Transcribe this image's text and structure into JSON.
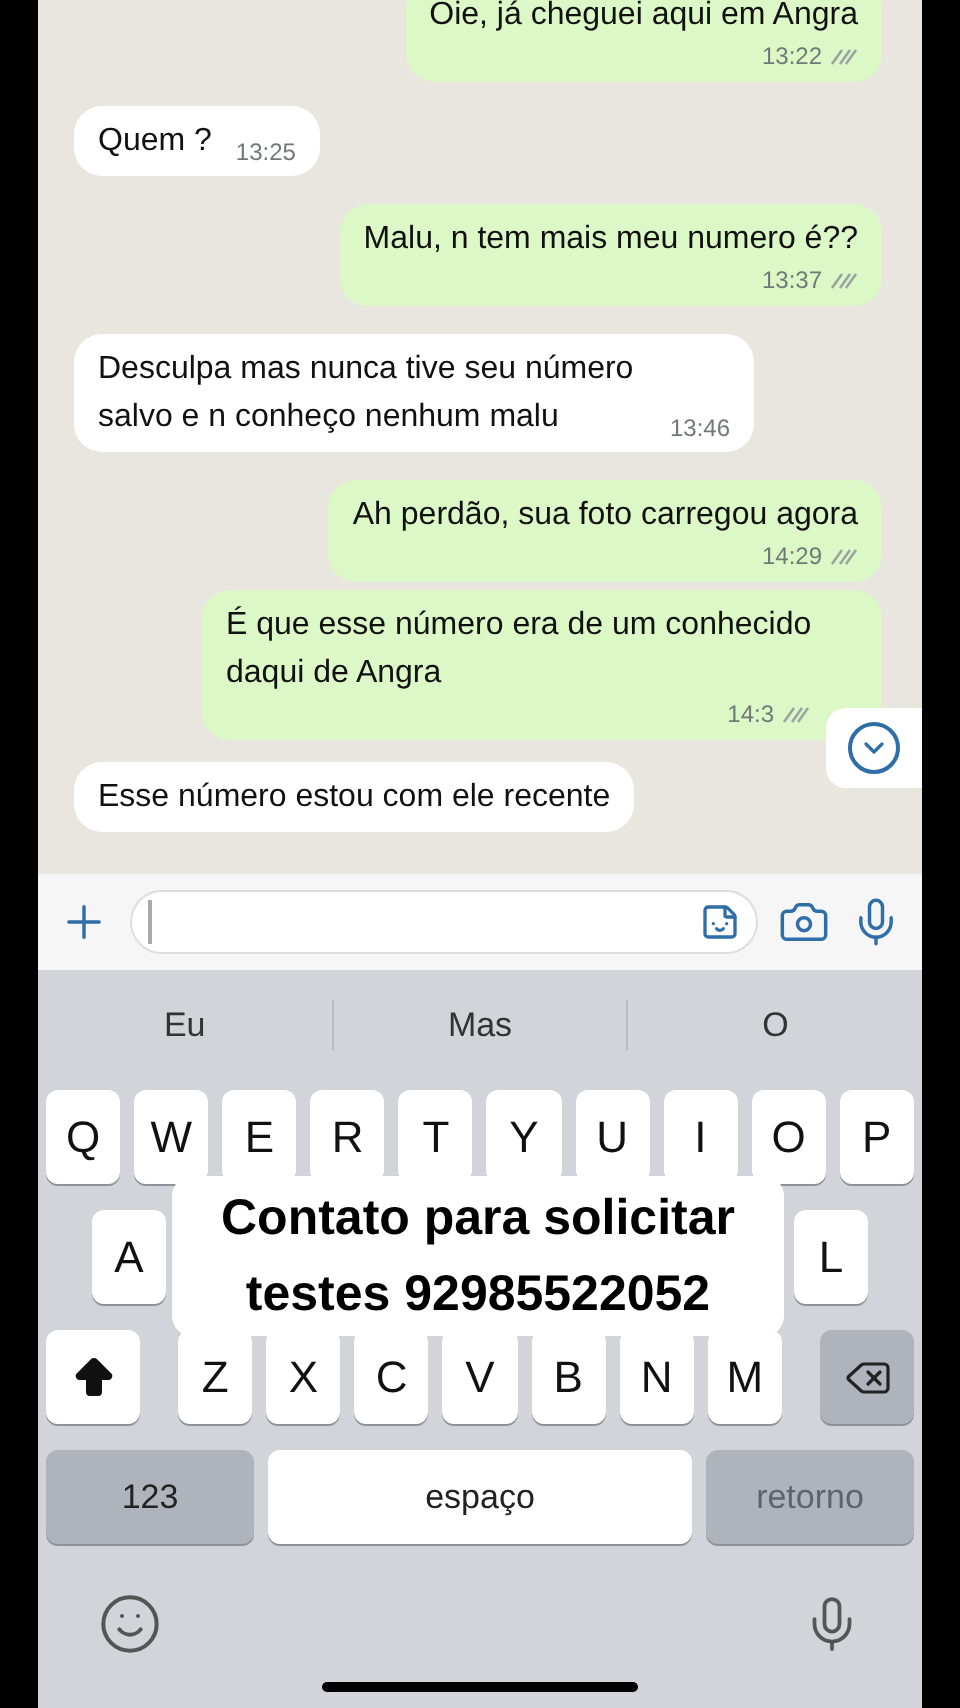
{
  "messages": [
    {
      "kind": "sent",
      "text": "Oie, já cheguei aqui em Angra",
      "time": "13:22"
    },
    {
      "kind": "received",
      "text": "Quem ?",
      "time": "13:25"
    },
    {
      "kind": "sent",
      "text": "Malu, n tem mais meu numero é??",
      "time": "13:37"
    },
    {
      "kind": "received",
      "text": "Desculpa mas nunca tive seu número salvo e n conheço nenhum malu",
      "time": "13:46"
    },
    {
      "kind": "sent",
      "text": "Ah perdão, sua foto carregou agora",
      "time": "14:29"
    },
    {
      "kind": "sent",
      "text": "É que esse número era de um conhecido daqui de Angra",
      "time": "14:3"
    },
    {
      "kind": "received",
      "text": "Esse número estou com ele recente"
    }
  ],
  "suggestions": [
    "Eu",
    "Mas",
    "O"
  ],
  "keyboard": {
    "row1": [
      "Q",
      "W",
      "E",
      "R",
      "T",
      "Y",
      "U",
      "I",
      "O",
      "P"
    ],
    "row2": [
      "A",
      "L"
    ],
    "row3": [
      "Z",
      "X",
      "C",
      "V",
      "B",
      "N",
      "M"
    ],
    "numbers": "123",
    "space": "espaço",
    "return": "retorno"
  },
  "caption": "Contato para solicitar testes 92985522052"
}
